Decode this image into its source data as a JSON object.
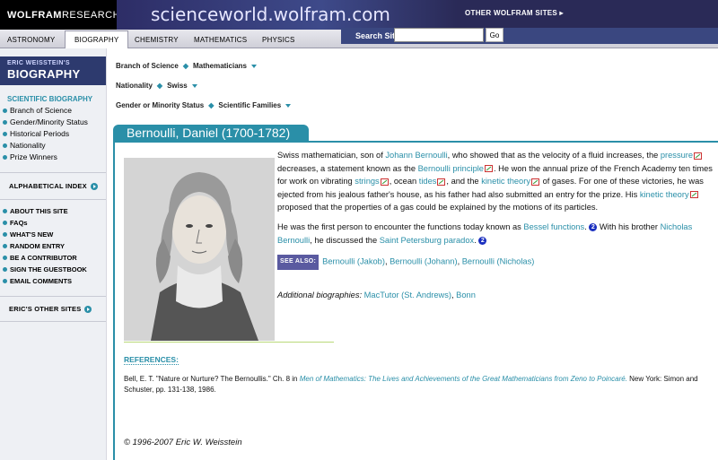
{
  "header": {
    "brand_bold": "WOLFRAM",
    "brand_rest": "RESEARCH",
    "site_title": "scienceworld.wolfram.com",
    "other_sites": "OTHER WOLFRAM SITES ▸"
  },
  "nav": {
    "tabs": [
      "ASTRONOMY",
      "BIOGRAPHY",
      "CHEMISTRY",
      "MATHEMATICS",
      "PHYSICS"
    ],
    "active": "BIOGRAPHY"
  },
  "search": {
    "label": "Search Site",
    "value": "",
    "go": "Go"
  },
  "sidebar": {
    "logo_line1": "ERIC WEISSTEIN'S",
    "logo_line2": "BIOGRAPHY",
    "section_title": "SCIENTIFIC BIOGRAPHY",
    "items": [
      "Branch of Science",
      "Gender/Minority Status",
      "Historical Periods",
      "Nationality",
      "Prize Winners"
    ],
    "alpha_index": "ALPHABETICAL INDEX",
    "links": [
      "ABOUT THIS SITE",
      "FAQs",
      "WHAT'S NEW",
      "RANDOM ENTRY",
      "BE A CONTRIBUTOR",
      "SIGN THE GUESTBOOK",
      "EMAIL COMMENTS"
    ],
    "other_sites": "ERIC'S OTHER SITES"
  },
  "breadcrumbs": [
    {
      "label": "Branch of Science",
      "value": "Mathematicians"
    },
    {
      "label": "Nationality",
      "value": "Swiss"
    },
    {
      "label": "Gender or Minority Status",
      "value": "Scientific Families"
    }
  ],
  "article": {
    "title": "Bernoulli, Daniel (1700-1782)",
    "p1": {
      "t1": "Swiss mathematician, son of ",
      "l_johann": "Johann Bernoulli",
      "t2": ", who showed that as the velocity of a fluid increases, the ",
      "l_pressure": "pressure",
      "t3": " decreases, a statement known as the ",
      "l_principle": "Bernoulli principle",
      "t4": ". He won the annual prize of the French Academy ten times for work on vibrating ",
      "l_strings": "strings",
      "t5": ", ocean ",
      "l_tides": "tides",
      "t6": ", and the ",
      "l_kinetic": "kinetic theory",
      "t7": " of gases. For one of these victories, he was ejected from his jealous father's house, as his father had also submitted an entry for the prize. His ",
      "l_kinetic2": "kinetic theory",
      "t8": " proposed that the properties of a gas could be explained by the motions of its particles."
    },
    "p2": {
      "t1": "He was the first person to encounter the functions today known as ",
      "l_bessel": "Bessel functions",
      "t2": ". ",
      "badge": "2",
      "t3": " With his brother ",
      "l_nicholas": "Nicholas Bernoulli",
      "t4": ", he discussed the ",
      "l_paradox": "Saint Petersburg paradox",
      "t5": ". ",
      "badge2": "2"
    },
    "see_also_label": "SEE ALSO:",
    "see_also": [
      "Bernoulli (Jakob)",
      "Bernoulli (Johann)",
      "Bernoulli (Nicholas)"
    ],
    "additional_label": "Additional biographies:",
    "additional": [
      "MacTutor (St. Andrews)",
      "Bonn"
    ],
    "references_head": "REFERENCES:",
    "reference": {
      "t1": "Bell, E. T. \"Nature or Nurture? The Bernoullis.\" Ch. 8 in ",
      "book": "Men of Mathematics: The Lives and Achievements of the Great Mathematicians from Zeno to Poincaré.",
      "t2": " New York: Simon and Schuster, pp. 131-138, 1986."
    },
    "copyright": "© 1996-2007 Eric W. Weisstein"
  },
  "colors": {
    "accent": "#2a8fa8",
    "header": "#2a2a57"
  }
}
